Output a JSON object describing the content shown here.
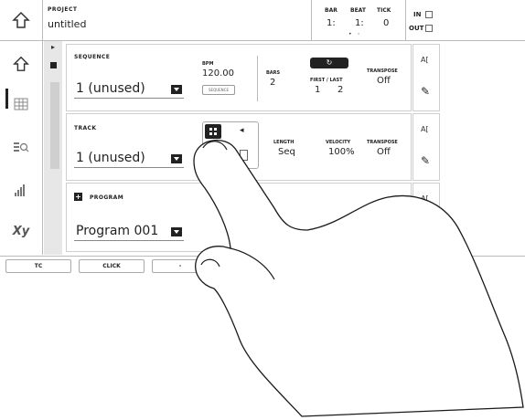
{
  "topbar": {
    "project_label": "PROJECT",
    "project_name": "untitled",
    "bar_label": "BAR",
    "bar_value": "1:",
    "beat_label": "BEAT",
    "beat_value": "1:",
    "tick_label": "TICK",
    "tick_value": "0",
    "in_label": "IN",
    "out_label": "OUT",
    "page_dots": "• ◦"
  },
  "sidebar": {
    "items": [
      {
        "icon": "home-icon",
        "glyph": "⇧"
      },
      {
        "icon": "grid-icon",
        "glyph": "▦"
      },
      {
        "icon": "list-search-icon",
        "glyph": "≡"
      },
      {
        "icon": "level-bars-icon",
        "glyph": "▮"
      },
      {
        "icon": "xy-icon",
        "glyph": "Xy"
      }
    ]
  },
  "sequence": {
    "label": "SEQUENCE",
    "value": "1  (unused)",
    "bpm_label": "BPM",
    "bpm_value": "120.00",
    "bpm_source": "SEQUENCE",
    "bars_label": "BARS",
    "bars_value": "2",
    "loop_label": "↻",
    "first_last_label": "FIRST / LAST",
    "first_value": "1",
    "last_value": "2",
    "transpose_label": "TRANSPOSE",
    "transpose_value": "Off"
  },
  "track": {
    "label": "TRACK",
    "value": "1  (unused)",
    "length_label": "LENGTH",
    "length_value": "Seq",
    "velocity_label": "VELOCITY",
    "velocity_value": "100%",
    "transpose_label": "TRANSPOSE",
    "transpose_value": "Off"
  },
  "program": {
    "add_label": "+",
    "label": "PROGRAM",
    "value": "Program 001"
  },
  "right_column": {
    "text_icon": "A[",
    "edit_icon": "✎"
  },
  "bottombar": {
    "tc_label": "TC",
    "click_label": "CLICK",
    "minus_label": "-"
  },
  "colors": {
    "background": "#ffffff",
    "border": "#bbbbbb",
    "dark": "#222222",
    "scroll": "#e7e7e7"
  }
}
